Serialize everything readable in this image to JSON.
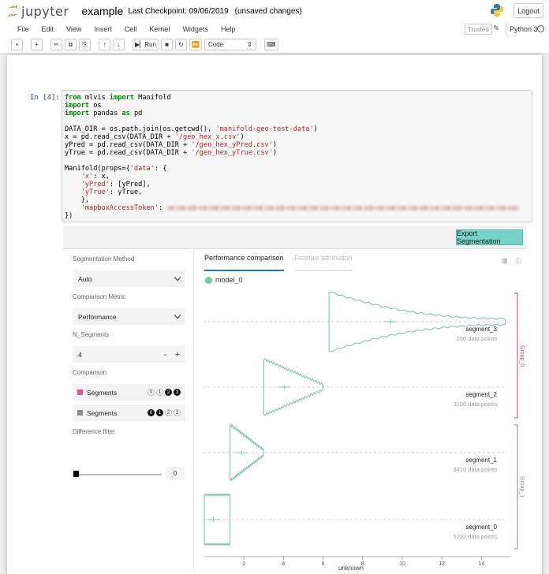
{
  "header": {
    "logo_text": "jupyter",
    "notebook_title": "example",
    "checkpoint": "Last Checkpoint: 09/06/2019",
    "unsaved": "(unsaved changes)",
    "logout_label": "Logout",
    "trusted_label": "Trusted",
    "kernel_name": "Python 3"
  },
  "menu": [
    "File",
    "Edit",
    "View",
    "Insert",
    "Cell",
    "Kernel",
    "Widgets",
    "Help"
  ],
  "toolbar": {
    "run_label": "Run",
    "cell_type": "Code"
  },
  "cell": {
    "prompt": "In [4]:"
  },
  "widget": {
    "export_label": "Export Segmentation",
    "segmentation_method_label": "Segmentation Method",
    "segmentation_method_value": "Auto",
    "comparison_metric_label": "Comparison Metric",
    "comparison_metric_value": "Performance",
    "n_segments_label": "N_Segments",
    "n_segments_value": "4",
    "stepper_minus": "-",
    "stepper_plus": "+",
    "comparison_label": "Comparison",
    "comparison_rows": [
      {
        "label": "Segments",
        "color": "#e0509a",
        "dots": [
          "0",
          "1",
          "2",
          "3"
        ],
        "on": [
          false,
          false,
          true,
          true
        ]
      },
      {
        "label": "Segments",
        "color": "#8c8c8c",
        "dots": [
          "0",
          "1",
          "2",
          "3"
        ],
        "on": [
          true,
          true,
          false,
          false
        ]
      }
    ],
    "difference_filter_label": "Difference filter",
    "difference_filter_value": "0",
    "tab_performance": "Performance comparison",
    "tab_feature": "Feature attribution",
    "legend_model": "model_0",
    "x_axis_label": "unknown",
    "x_ticks": [
      "2",
      "4",
      "6",
      "8",
      "10",
      "12",
      "14"
    ],
    "segments": [
      {
        "name": "segment_3",
        "points": "260 data points"
      },
      {
        "name": "segment_2",
        "points": "1108 data points"
      },
      {
        "name": "segment_1",
        "points": "3410 data points"
      },
      {
        "name": "segment_0",
        "points": "5222 data points"
      }
    ],
    "groups": [
      "Group_0",
      "Group_1"
    ],
    "colors": {
      "model": "#7cc8a4",
      "group0": "#c0407a",
      "group1": "#888888",
      "accent": "#76d3c8"
    }
  }
}
